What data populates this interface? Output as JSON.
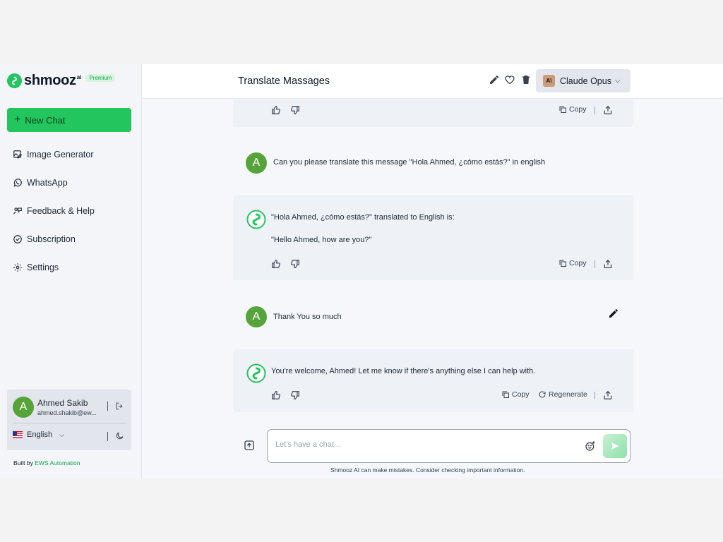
{
  "brand": {
    "name": "shmooz",
    "suffix": "ai",
    "badge": "Premium"
  },
  "sidebar": {
    "new_chat": "New Chat",
    "items": [
      {
        "label": "Image Generator",
        "icon": "image-edit-icon"
      },
      {
        "label": "WhatsApp",
        "icon": "whatsapp-icon"
      },
      {
        "label": "Feedback & Help",
        "icon": "feedback-icon"
      },
      {
        "label": "Subscription",
        "icon": "badge-check-icon"
      },
      {
        "label": "Settings",
        "icon": "gear-icon"
      }
    ],
    "user": {
      "initial": "A",
      "name": "Ahmed Sakib",
      "email": "ahmed.shakib@ew..."
    },
    "language": "English",
    "built_by_prefix": "Built by ",
    "built_by_link": "EWS Automation"
  },
  "header": {
    "title": "Translate Massages",
    "model": "Claude Opus",
    "model_logo": "A\\"
  },
  "messages": {
    "user1": {
      "initial": "A",
      "text": "Can you please translate this message \"Hola Ahmed, ¿cómo estás?\" in english"
    },
    "ai1": {
      "line1": "\"Hola Ahmed, ¿cómo estás?\" translated to English is:",
      "line2": "\"Hello Ahmed, how are you?\""
    },
    "user2": {
      "initial": "A",
      "text": "Thank You so much"
    },
    "ai2": {
      "text": "You're welcome, Ahmed! Let me know if there's anything else I can help with."
    }
  },
  "actions": {
    "copy": "Copy",
    "regenerate": "Regenerate"
  },
  "composer": {
    "placeholder": "Let's have a chat..."
  },
  "disclaimer": "Shmooz AI can make mistakes. Consider checking important information.",
  "colors": {
    "accent": "#22c55e",
    "avatar": "#56a33a",
    "model_logo": "#cc9b7a"
  }
}
